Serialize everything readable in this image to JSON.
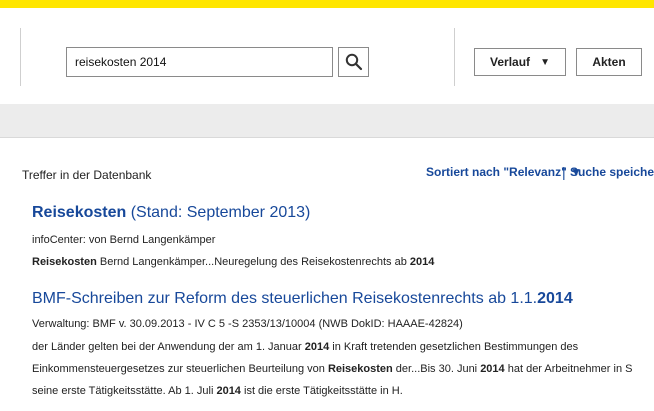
{
  "toolbar": {
    "search": {
      "value": "reisekosten 2014"
    },
    "history_label": "Verlauf",
    "files_label": "Akten"
  },
  "results": {
    "header": "Treffer in der Datenbank",
    "sort": {
      "prefix": "Sortiert nach \"Relevanz\"",
      "arrow": "▼"
    },
    "separator": "|",
    "save_search": "Suche speichern",
    "items": [
      {
        "title_bold": "Reisekosten",
        "title_rest": " (Stand: September 2013)",
        "meta": "infoCenter: von Bernd Langenkämper",
        "snippet": [
          {
            "b": "Reisekosten"
          },
          {
            "t": " Bernd Langenkämper...Neuregelung des Reisekostenrechts ab "
          },
          {
            "b": "2014"
          }
        ]
      },
      {
        "title_plain": "BMF-Schreiben zur Reform des steuerlichen Reisekostenrechts ab 1.1.",
        "title_bold_end": "2014",
        "meta": "Verwaltung: BMF v. 30.09.2013 - IV C 5 -S 2353/13/10004 (NWB DokID: HAAAE-42824)",
        "snippet_lines": [
          [
            {
              "t": "der Länder gelten bei der Anwendung der am 1. Januar "
            },
            {
              "b": "2014"
            },
            {
              "t": " in Kraft tretenden gesetzlichen Bestimmungen des"
            }
          ],
          [
            {
              "t": "Einkommensteuergesetzes zur steuerlichen Beurteilung von "
            },
            {
              "b": "Reisekosten"
            },
            {
              "t": " der...Bis 30. Juni "
            },
            {
              "b": "2014"
            },
            {
              "t": " hat der Arbeitnehmer in S"
            }
          ],
          [
            {
              "t": "seine erste Tätigkeitsstätte. Ab 1. Juli "
            },
            {
              "b": "2014"
            },
            {
              "t": " ist die erste Tätigkeitsstätte in H."
            }
          ]
        ]
      }
    ]
  },
  "icons": {
    "search": "magnifier-icon",
    "dropdown": "caret-down-icon"
  },
  "colors": {
    "accent_bar": "#ffe600",
    "link": "#17489a",
    "strip": "#ececec"
  }
}
